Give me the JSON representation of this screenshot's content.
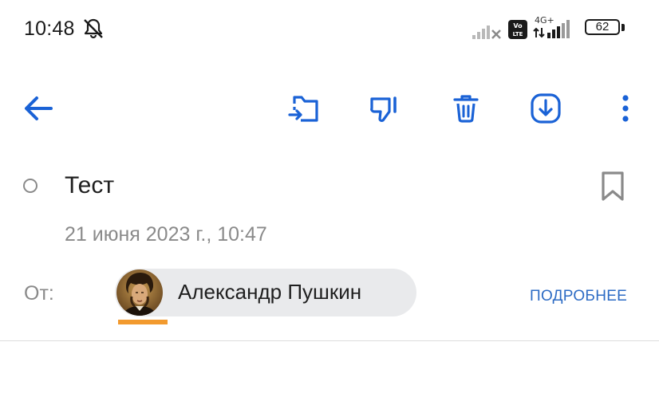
{
  "status_bar": {
    "time": "10:48",
    "network_type": "4G+",
    "battery_level": "62",
    "icons": [
      "mute-notifications-icon",
      "signal-icon",
      "volte-icon",
      "data-arrows-icon",
      "signal-icon",
      "battery-icon"
    ]
  },
  "toolbar": {
    "icons": [
      "back-arrow-icon",
      "move-to-folder-icon",
      "thumbs-down-icon",
      "trash-icon",
      "download-icon",
      "more-vertical-icon"
    ],
    "accent_color": "#1a62d6"
  },
  "message": {
    "subject": "Тест",
    "date": "21 июня 2023 г., 10:47",
    "from_label": "От:",
    "sender_name": "Александр Пушкин",
    "details_link": "ПОДРОБНЕЕ"
  },
  "colors": {
    "muted_text": "#8a8a8a",
    "chip_background": "#e9eaec",
    "link": "#2c6bc4",
    "avatar_underline": "#f29a2e"
  }
}
